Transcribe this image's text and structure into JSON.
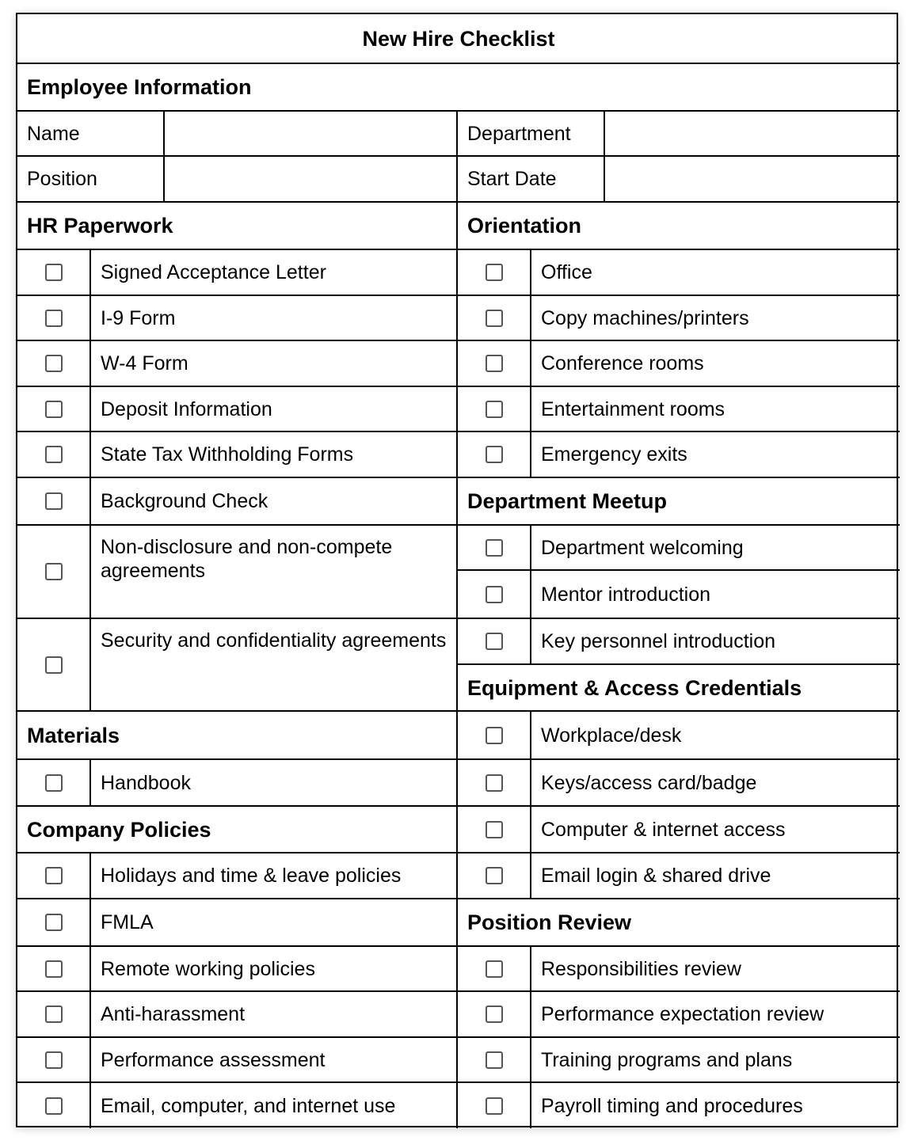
{
  "title": "New Hire Checklist",
  "employee_info": {
    "heading": "Employee Information",
    "fields": [
      {
        "label": "Name",
        "value": ""
      },
      {
        "label": "Department",
        "value": ""
      },
      {
        "label": "Position",
        "value": ""
      },
      {
        "label": "Start Date",
        "value": ""
      }
    ]
  },
  "sections": {
    "hr_paperwork": {
      "heading": "HR Paperwork",
      "items": [
        {
          "label": "Signed Acceptance Letter",
          "checked": false
        },
        {
          "label": "I-9 Form",
          "checked": false
        },
        {
          "label": "W-4 Form",
          "checked": false
        },
        {
          "label": "Deposit Information",
          "checked": false
        },
        {
          "label": "State Tax Withholding Forms",
          "checked": false
        },
        {
          "label": "Background Check",
          "checked": false
        },
        {
          "label": "Non-disclosure and non-compete agreements",
          "checked": false
        },
        {
          "label": "Security and confidentiality agreements",
          "checked": false
        }
      ]
    },
    "materials": {
      "heading": "Materials",
      "items": [
        {
          "label": "Handbook",
          "checked": false
        }
      ]
    },
    "company_policies": {
      "heading": "Company Policies",
      "items": [
        {
          "label": "Holidays and time & leave policies",
          "checked": false
        },
        {
          "label": "FMLA",
          "checked": false
        },
        {
          "label": "Remote working policies",
          "checked": false
        },
        {
          "label": "Anti-harassment",
          "checked": false
        },
        {
          "label": "Performance assessment",
          "checked": false
        },
        {
          "label": "Email, computer, and internet use",
          "checked": false
        }
      ]
    },
    "orientation": {
      "heading": "Orientation",
      "items": [
        {
          "label": "Office",
          "checked": false
        },
        {
          "label": "Copy machines/printers",
          "checked": false
        },
        {
          "label": "Conference rooms",
          "checked": false
        },
        {
          "label": "Entertainment rooms",
          "checked": false
        },
        {
          "label": "Emergency exits",
          "checked": false
        }
      ]
    },
    "department_meetup": {
      "heading": "Department Meetup",
      "items": [
        {
          "label": "Department welcoming",
          "checked": false
        },
        {
          "label": "Mentor introduction",
          "checked": false
        },
        {
          "label": "Key personnel introduction",
          "checked": false
        }
      ]
    },
    "equipment": {
      "heading": "Equipment & Access Credentials",
      "items": [
        {
          "label": "Workplace/desk",
          "checked": false
        },
        {
          "label": "Keys/access card/badge",
          "checked": false
        },
        {
          "label": "Computer & internet access",
          "checked": false
        },
        {
          "label": "Email login & shared drive",
          "checked": false
        }
      ]
    },
    "position_review": {
      "heading": "Position Review",
      "items": [
        {
          "label": "Responsibilities review",
          "checked": false
        },
        {
          "label": "Performance expectation review",
          "checked": false
        },
        {
          "label": "Training programs and plans",
          "checked": false
        },
        {
          "label": "Payroll timing and procedures",
          "checked": false
        }
      ]
    }
  }
}
